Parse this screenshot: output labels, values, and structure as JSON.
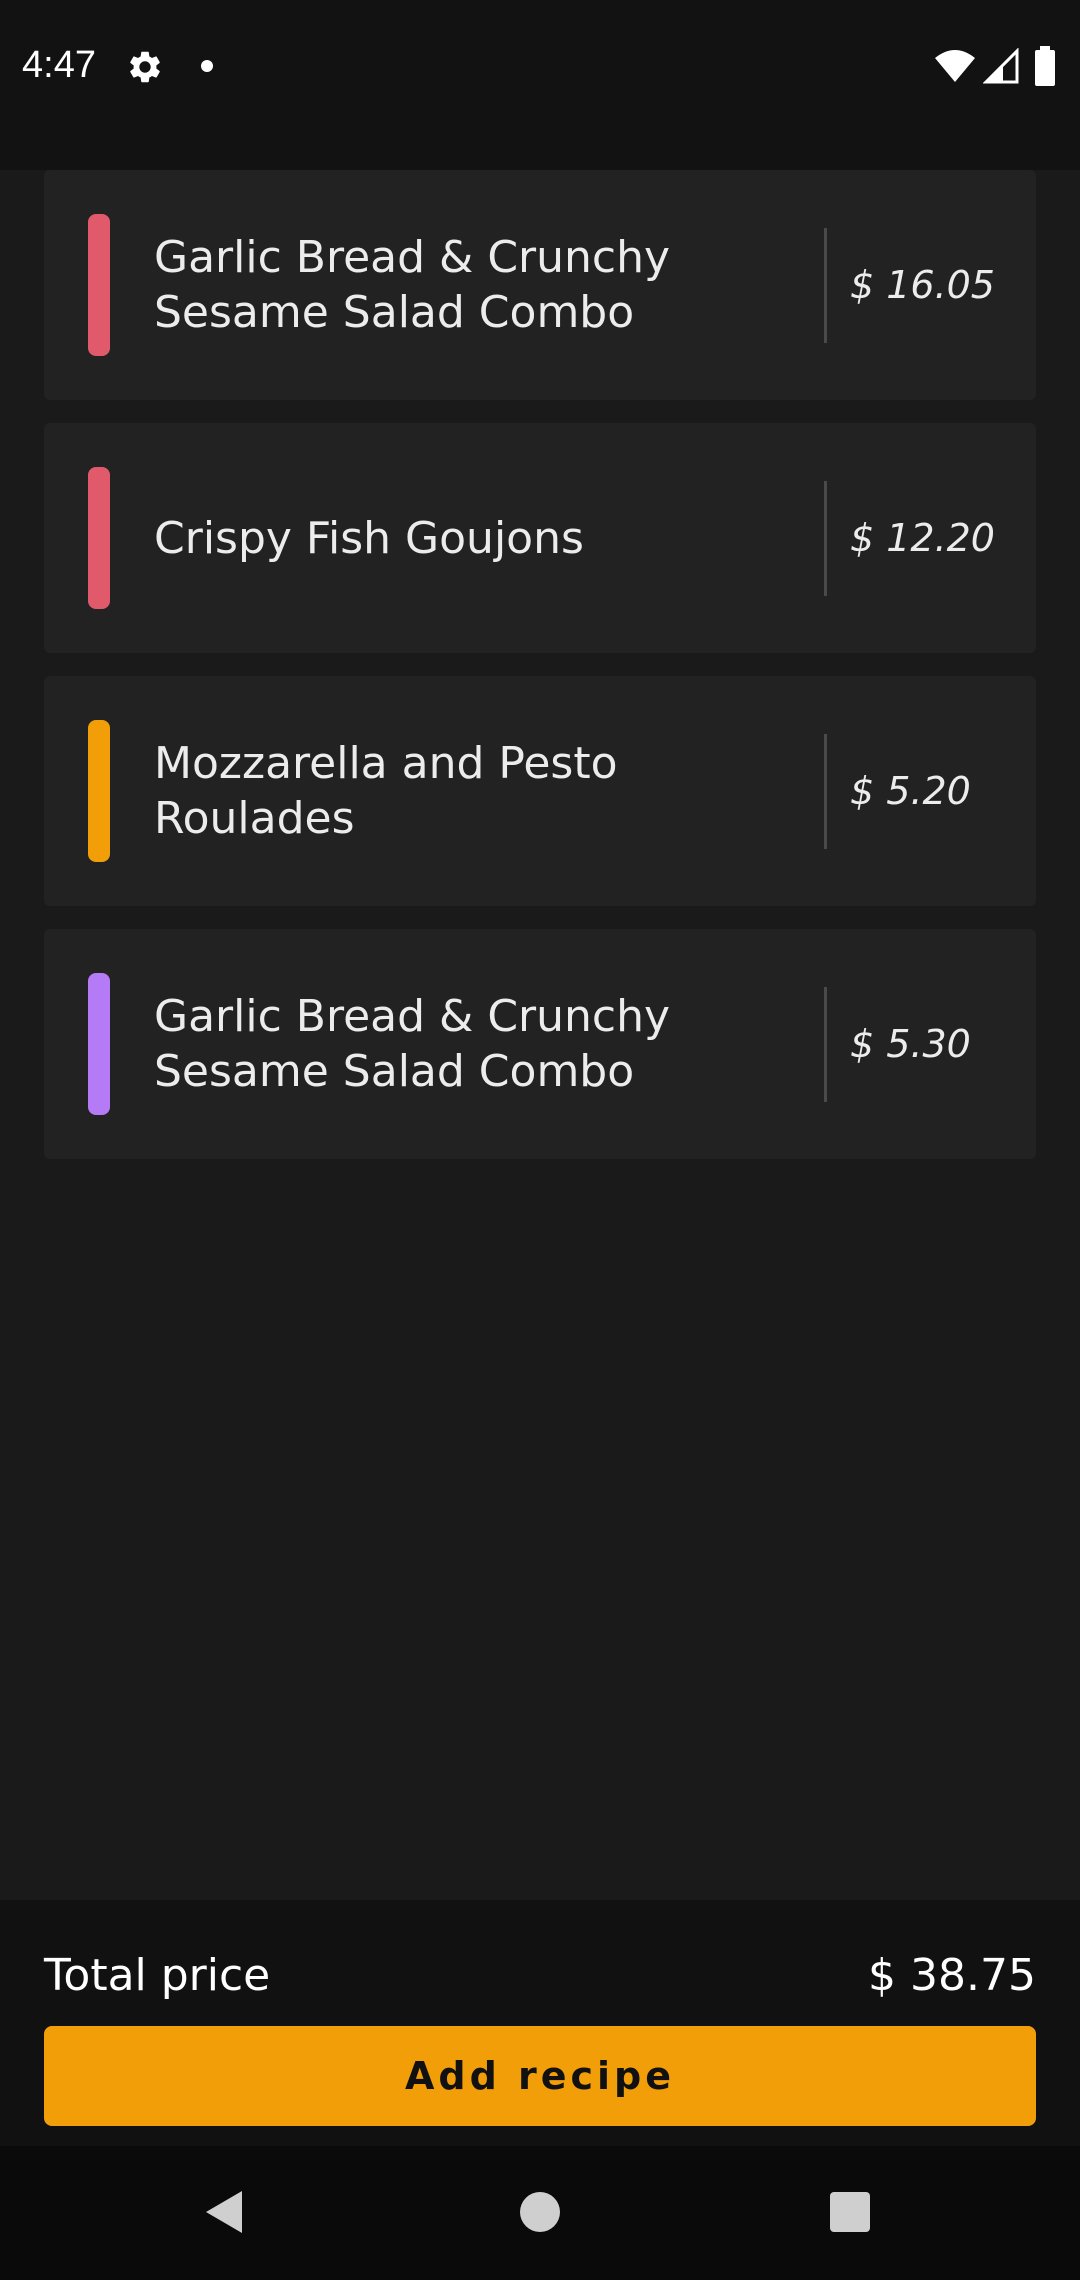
{
  "status_bar": {
    "time": "4:47",
    "icons": [
      "gear-icon",
      "notification-dot-icon",
      "wifi-icon",
      "signal-icon",
      "battery-icon"
    ]
  },
  "cart": {
    "items": [
      {
        "name": "Garlic Bread & Crunchy Sesame Salad Combo",
        "currency": "$",
        "price": "16.05",
        "accent": "#e05a6c"
      },
      {
        "name": "Crispy Fish Goujons",
        "currency": "$",
        "price": "12.20",
        "accent": "#e05a6c"
      },
      {
        "name": "Mozzarella and Pesto Roulades",
        "currency": "$",
        "price": "5.20",
        "accent": "#f29e08"
      },
      {
        "name": "Garlic Bread & Crunchy Sesame Salad Combo",
        "currency": "$",
        "price": "5.30",
        "accent": "#b57bf7"
      }
    ]
  },
  "footer": {
    "total_label": "Total price",
    "total_value": "$ 38.75",
    "add_button_label": "Add recipe",
    "button_color": "#f29e08"
  },
  "nav_bar": {
    "icons": [
      "back-icon",
      "home-icon",
      "recents-icon"
    ]
  }
}
